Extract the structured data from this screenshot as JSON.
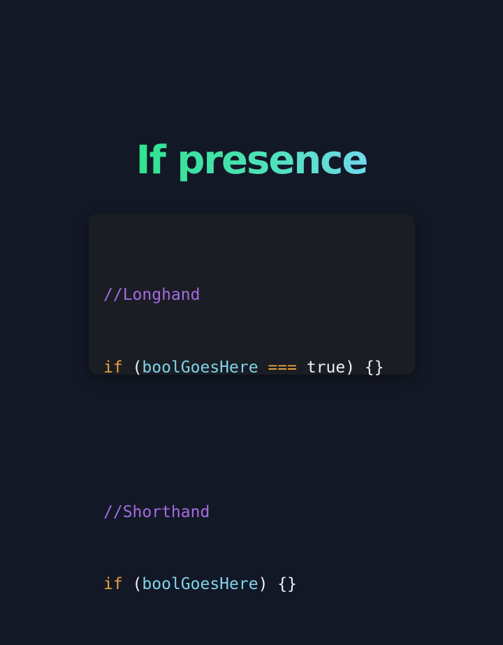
{
  "title": "If presence",
  "colors": {
    "background": "#131826",
    "card": "#1a1d24",
    "title_gradient_start": "#2fe38f",
    "title_gradient_end": "#6fd9ec",
    "comment": "#a46be0",
    "keyword": "#e7a23b",
    "identifier": "#7fd4e8",
    "plain": "#eef0f4"
  },
  "code": {
    "longhand": {
      "comment": "//Longhand",
      "keyword": "if",
      "open_paren": " (",
      "identifier": "boolGoesHere",
      "operator": " === ",
      "value": "true",
      "close": ") {}"
    },
    "shorthand": {
      "comment": "//Shorthand",
      "keyword": "if",
      "open_paren": " (",
      "identifier": "boolGoesHere",
      "close": ") {}"
    }
  }
}
